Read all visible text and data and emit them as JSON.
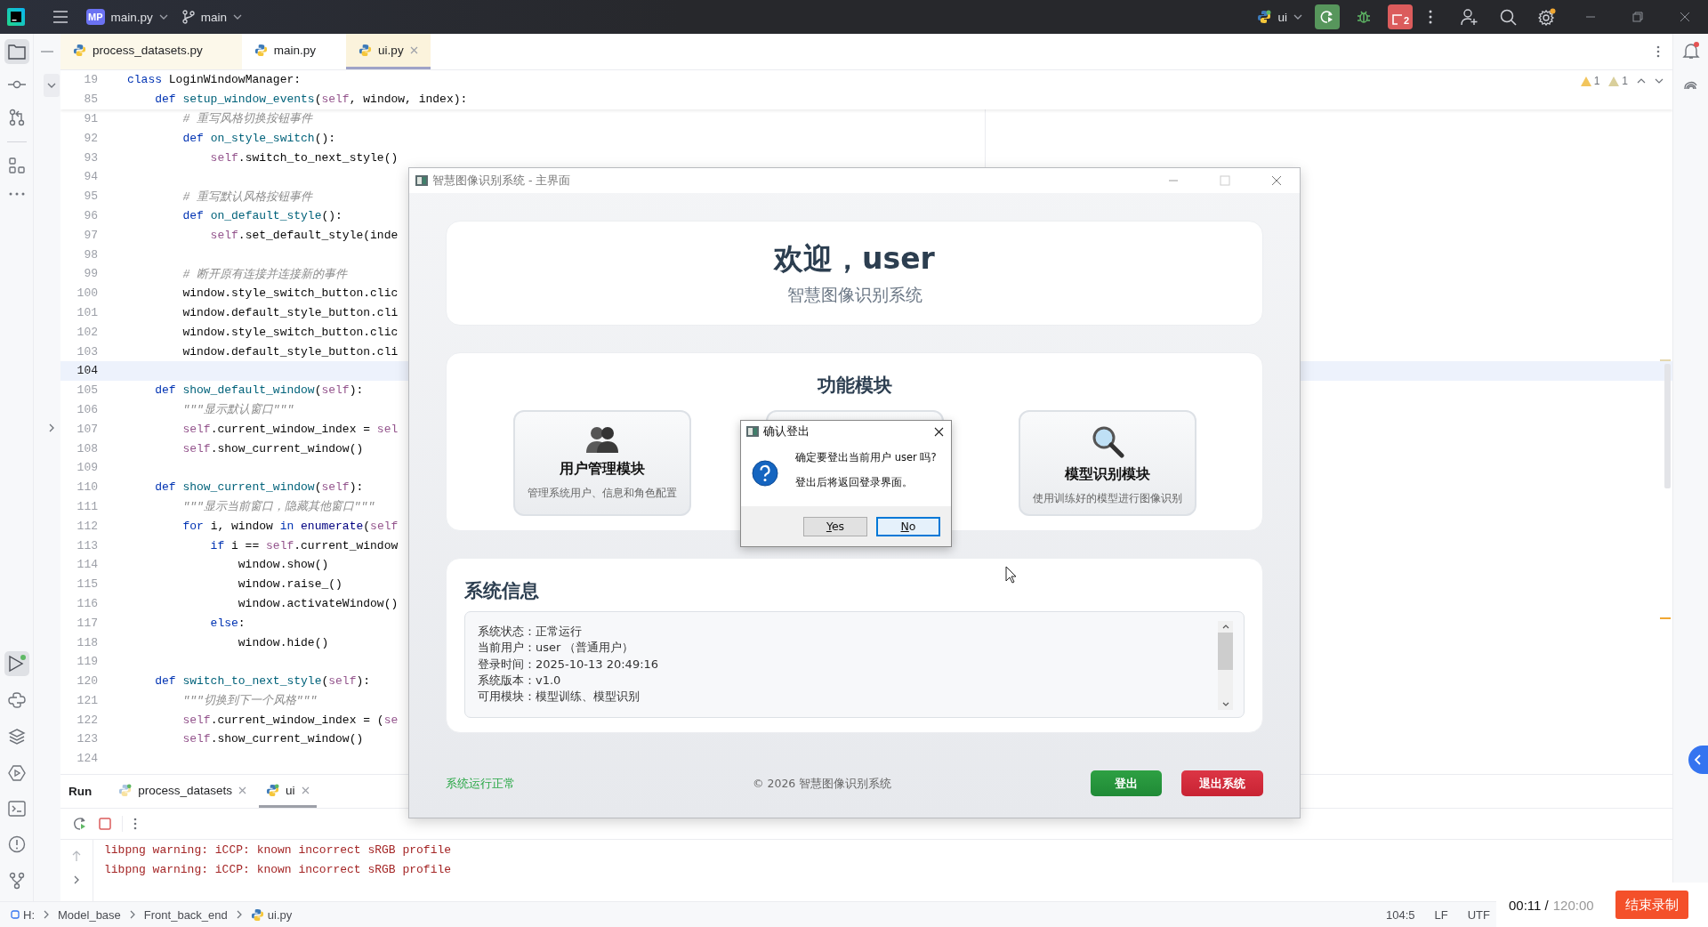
{
  "topbar": {
    "project_badge": "MP",
    "project": "main.py",
    "branch": "main",
    "run_config": "ui",
    "stop_count": "2"
  },
  "editor_tabs": [
    {
      "label": "process_datasets.py",
      "selected": false
    },
    {
      "label": "main.py",
      "selected": false
    },
    {
      "label": "ui.py",
      "selected": true
    }
  ],
  "inspections": [
    "1",
    "1"
  ],
  "code_lines": [
    {
      "num": "19",
      "sticky": true,
      "current": false,
      "tokens": [
        {
          "kind": "kw",
          "text": "class"
        },
        {
          "kind": "tx",
          "text": " LoginWindowManager:"
        }
      ]
    },
    {
      "num": "85",
      "sticky": true,
      "current": false,
      "tokens": [
        {
          "kind": "kw",
          "text": "    def"
        },
        {
          "kind": "fn",
          "text": " setup_window_events"
        },
        {
          "kind": "tx",
          "text": "("
        },
        {
          "kind": "self",
          "text": "self"
        },
        {
          "kind": "tx",
          "text": ", window, index):"
        }
      ]
    },
    {
      "num": "91",
      "sticky": false,
      "current": false,
      "tokens": [
        {
          "kind": "cm",
          "text": "        # 重写风格切换按钮事件"
        }
      ]
    },
    {
      "num": "92",
      "sticky": false,
      "current": false,
      "tokens": [
        {
          "kind": "kw",
          "text": "        def"
        },
        {
          "kind": "fn",
          "text": " on_style_switch"
        },
        {
          "kind": "tx",
          "text": "():"
        }
      ]
    },
    {
      "num": "93",
      "sticky": false,
      "current": false,
      "tokens": [
        {
          "kind": "self",
          "text": "            self"
        },
        {
          "kind": "tx",
          "text": ".switch_to_next_style()"
        }
      ]
    },
    {
      "num": "94",
      "sticky": false,
      "current": false
    },
    {
      "num": "95",
      "sticky": false,
      "current": false,
      "tokens": [
        {
          "kind": "cm",
          "text": "        # 重写默认风格按钮事件"
        }
      ]
    },
    {
      "num": "96",
      "sticky": false,
      "current": false,
      "tokens": [
        {
          "kind": "kw",
          "text": "        def"
        },
        {
          "kind": "fn",
          "text": " on_default_style"
        },
        {
          "kind": "tx",
          "text": "():"
        }
      ]
    },
    {
      "num": "97",
      "sticky": false,
      "current": false,
      "tokens": [
        {
          "kind": "self",
          "text": "            self"
        },
        {
          "kind": "tx",
          "text": ".set_default_style(inde"
        }
      ]
    },
    {
      "num": "98",
      "sticky": false,
      "current": false
    },
    {
      "num": "99",
      "sticky": false,
      "current": false,
      "tokens": [
        {
          "kind": "cm",
          "text": "        # 断开原有连接并连接新的事件"
        }
      ]
    },
    {
      "num": "100",
      "sticky": false,
      "current": false,
      "tokens": [
        {
          "kind": "tx",
          "text": "        window.style_switch_button.clic"
        }
      ]
    },
    {
      "num": "101",
      "sticky": false,
      "current": false,
      "tokens": [
        {
          "kind": "tx",
          "text": "        window.default_style_button.cli"
        }
      ]
    },
    {
      "num": "102",
      "sticky": false,
      "current": false,
      "tokens": [
        {
          "kind": "tx",
          "text": "        window.style_switch_button.clic"
        }
      ]
    },
    {
      "num": "103",
      "sticky": false,
      "current": false,
      "tokens": [
        {
          "kind": "tx",
          "text": "        window.default_style_button.cli"
        }
      ]
    },
    {
      "num": "104",
      "sticky": false,
      "current": true
    },
    {
      "num": "105",
      "sticky": false,
      "current": false,
      "tokens": [
        {
          "kind": "kw",
          "text": "    def"
        },
        {
          "kind": "fn",
          "text": " show_default_window"
        },
        {
          "kind": "tx",
          "text": "("
        },
        {
          "kind": "self",
          "text": "self"
        },
        {
          "kind": "tx",
          "text": "):"
        }
      ]
    },
    {
      "num": "106",
      "sticky": false,
      "current": false,
      "tokens": [
        {
          "kind": "cm",
          "text": "        \"\"\"显示默认窗口\"\"\""
        }
      ]
    },
    {
      "num": "107",
      "sticky": false,
      "current": false,
      "tokens": [
        {
          "kind": "self",
          "text": "        self"
        },
        {
          "kind": "tx",
          "text": ".current_window_index = "
        },
        {
          "kind": "self",
          "text": "sel"
        }
      ]
    },
    {
      "num": "108",
      "sticky": false,
      "current": false,
      "tokens": [
        {
          "kind": "self",
          "text": "        self"
        },
        {
          "kind": "tx",
          "text": ".show_current_window()"
        }
      ]
    },
    {
      "num": "109",
      "sticky": false,
      "current": false
    },
    {
      "num": "110",
      "sticky": false,
      "current": false,
      "tokens": [
        {
          "kind": "kw",
          "text": "    def"
        },
        {
          "kind": "fn",
          "text": " show_current_window"
        },
        {
          "kind": "tx",
          "text": "("
        },
        {
          "kind": "self",
          "text": "self"
        },
        {
          "kind": "tx",
          "text": "):"
        }
      ]
    },
    {
      "num": "111",
      "sticky": false,
      "current": false,
      "tokens": [
        {
          "kind": "cm",
          "text": "        \"\"\"显示当前窗口，隐藏其他窗口\"\"\""
        }
      ]
    },
    {
      "num": "112",
      "sticky": false,
      "current": false,
      "tokens": [
        {
          "kind": "kw",
          "text": "        for"
        },
        {
          "kind": "tx",
          "text": " i, window "
        },
        {
          "kind": "kw",
          "text": "in"
        },
        {
          "kind": "bi",
          "text": " enumerate"
        },
        {
          "kind": "tx",
          "text": "("
        },
        {
          "kind": "self",
          "text": "self"
        }
      ]
    },
    {
      "num": "113",
      "sticky": false,
      "current": false,
      "tokens": [
        {
          "kind": "kw",
          "text": "            if"
        },
        {
          "kind": "tx",
          "text": " i == "
        },
        {
          "kind": "self",
          "text": "self"
        },
        {
          "kind": "tx",
          "text": ".current_window"
        }
      ]
    },
    {
      "num": "114",
      "sticky": false,
      "current": false,
      "tokens": [
        {
          "kind": "tx",
          "text": "                window.show()"
        }
      ]
    },
    {
      "num": "115",
      "sticky": false,
      "current": false,
      "tokens": [
        {
          "kind": "tx",
          "text": "                window.raise_()"
        }
      ]
    },
    {
      "num": "116",
      "sticky": false,
      "current": false,
      "tokens": [
        {
          "kind": "tx",
          "text": "                window.activateWindow()"
        }
      ]
    },
    {
      "num": "117",
      "sticky": false,
      "current": false,
      "tokens": [
        {
          "kind": "kw",
          "text": "            else"
        },
        {
          "kind": "tx",
          "text": ":"
        }
      ]
    },
    {
      "num": "118",
      "sticky": false,
      "current": false,
      "tokens": [
        {
          "kind": "tx",
          "text": "                window.hide()"
        }
      ]
    },
    {
      "num": "119",
      "sticky": false,
      "current": false
    },
    {
      "num": "120",
      "sticky": false,
      "current": false,
      "tokens": [
        {
          "kind": "kw",
          "text": "    def"
        },
        {
          "kind": "fn",
          "text": " switch_to_next_style"
        },
        {
          "kind": "tx",
          "text": "("
        },
        {
          "kind": "self",
          "text": "self"
        },
        {
          "kind": "tx",
          "text": "):"
        }
      ]
    },
    {
      "num": "121",
      "sticky": false,
      "current": false,
      "tokens": [
        {
          "kind": "cm",
          "text": "        \"\"\"切换到下一个风格\"\"\""
        }
      ]
    },
    {
      "num": "122",
      "sticky": false,
      "current": false,
      "tokens": [
        {
          "kind": "self",
          "text": "        self"
        },
        {
          "kind": "tx",
          "text": ".current_window_index = ("
        },
        {
          "kind": "self",
          "text": "se"
        }
      ]
    },
    {
      "num": "123",
      "sticky": false,
      "current": false,
      "tokens": [
        {
          "kind": "self",
          "text": "        self"
        },
        {
          "kind": "tx",
          "text": ".show_current_window()"
        }
      ]
    },
    {
      "num": "124",
      "sticky": false,
      "current": false
    }
  ],
  "run_panel": {
    "title": "Run",
    "tabs": [
      {
        "label": "process_datasets",
        "selected": false
      },
      {
        "label": "ui",
        "selected": true
      }
    ],
    "console": [
      "libpng warning: iCCP: known incorrect sRGB profile",
      "libpng warning: iCCP: known incorrect sRGB profile"
    ]
  },
  "status_bar": {
    "breadcrumbs": [
      "H:",
      "Model_base",
      "Front_back_end",
      "ui.py"
    ],
    "position": "104:5",
    "line_ending": "LF",
    "encoding": "UTF"
  },
  "app_window": {
    "title": "智慧图像识别系统 - 主界面",
    "welcome": "欢迎，user",
    "subtitle": "智慧图像识别系统",
    "modules_title": "功能模块",
    "modules": [
      {
        "kind": "module",
        "title": "用户管理模块",
        "desc": "管理系统用户、信息和角色配置"
      },
      {
        "kind": "covered"
      },
      {
        "kind": "module",
        "title": "模型识别模块",
        "desc": "使用训练好的模型进行图像识别"
      }
    ],
    "info_title": "系统信息",
    "info_lines": [
      "系统状态：正常运行",
      "当前用户：user （普通用户）",
      "登录时间：2025-10-13 20:49:16",
      "系统版本：v1.0",
      "可用模块：模型训练、模型识别"
    ],
    "status": "系统运行正常",
    "copyright": "© 2026 智慧图像识别系统",
    "buttons": [
      {
        "label": "登出",
        "kind": "logout"
      },
      {
        "label": "退出系统",
        "kind": "exit"
      }
    ]
  },
  "dialog": {
    "title": "确认登出",
    "message": "确定要登出当前用户 user 吗?",
    "detail": "登出后将返回登录界面。",
    "buttons": [
      {
        "label": "Yes",
        "selected": false
      },
      {
        "label": "No",
        "selected": true
      }
    ]
  },
  "recording": {
    "elapsed": "00:11 /",
    "limit": "120:00",
    "button": "结束录制"
  }
}
